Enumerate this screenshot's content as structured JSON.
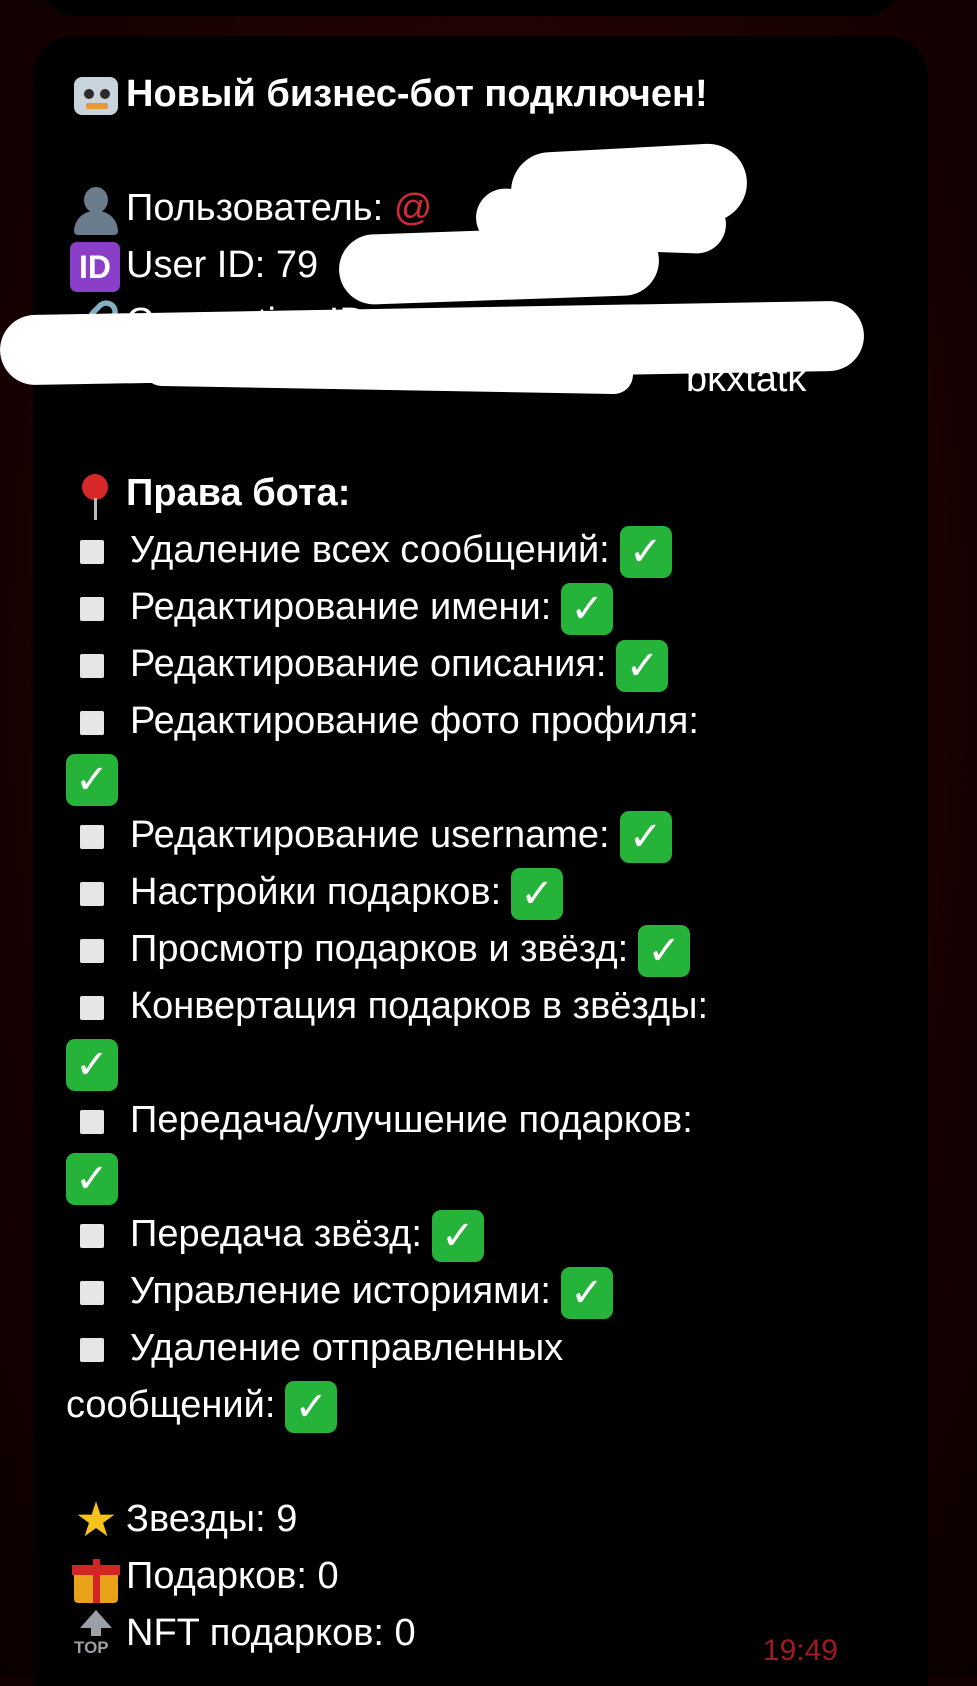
{
  "message": {
    "title": "Новый бизнес-бот подключен!",
    "user_label": "Пользователь: ",
    "user_mention": "@",
    "user_id": "User ID: 79",
    "connection_label": "Connection ID:",
    "connection_tail": "bkxtatk",
    "rights_title": "Права бота:",
    "rights": [
      "Удаление всех сообщений:",
      "Редактирование имени:",
      "Редактирование описания:",
      "Редактирование фото профиля:",
      "Редактирование username:",
      "Настройки подарков:",
      "Просмотр подарков и звёзд:",
      "Конвертация подарков в звёзды:",
      "Передача/улучшение подарков:",
      "Передача звёзд:",
      "Управление историями:",
      "Удаление отправленных"
    ],
    "rights_last_wrap": "сообщений:",
    "stars": "Звезды: 9",
    "gifts": "Подарков: 0",
    "nft_gifts": "NFT подарков: 0",
    "time": "19:49"
  },
  "icons": {
    "title": "robot-icon",
    "user": "bust-icon",
    "id": "id-icon",
    "connection": "link-icon",
    "rights": "pushpin-icon",
    "bullet": "square-bullet-icon",
    "check": "check-mark-icon",
    "stars": "star-icon",
    "gifts": "gift-icon",
    "nft": "top-arrow-icon",
    "id_text": "ID",
    "top_text": "TOP"
  },
  "colors": {
    "mention": "#d02a34",
    "check": "#26b33a",
    "time": "#a01a22"
  }
}
